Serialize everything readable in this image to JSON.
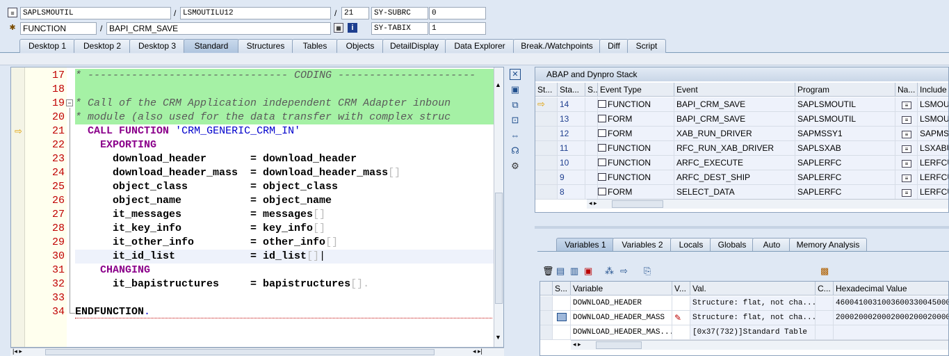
{
  "header": {
    "row1": {
      "program": "SAPLSMOUTIL",
      "include": "LSMOUTILU12",
      "line": "21",
      "sysvar": "SY-SUBRC",
      "sysval": "0"
    },
    "row2": {
      "type": "FUNCTION",
      "name": "BAPI_CRM_SAVE",
      "sysvar": "SY-TABIX",
      "sysval": "1"
    },
    "slash": "/"
  },
  "tabs": [
    "Desktop 1",
    "Desktop 2",
    "Desktop 3",
    "Standard",
    "Structures",
    "Tables",
    "Objects",
    "DetailDisplay",
    "Data Explorer",
    "Break./Watchpoints",
    "Diff",
    "Script"
  ],
  "active_tab": "Standard",
  "editor": {
    "lines": [
      {
        "n": "17",
        "segs": [
          {
            "t": "* -------------------------------- CODING ----------------------",
            "c": "cmt"
          }
        ]
      },
      {
        "n": "18",
        "segs": [
          {
            "t": "",
            "c": "cmt"
          }
        ]
      },
      {
        "n": "19",
        "segs": [
          {
            "t": "* Call of the CRM Application independent CRM Adapter inboun",
            "c": "cmt"
          }
        ]
      },
      {
        "n": "20",
        "segs": [
          {
            "t": "* module (also used for the data transfer with complex struc",
            "c": "cmt"
          }
        ]
      },
      {
        "n": "21",
        "segs": [
          {
            "t": "  ",
            "c": ""
          },
          {
            "t": "CALL FUNCTION",
            "c": "kw"
          },
          {
            "t": " ",
            "c": ""
          },
          {
            "t": "'CRM_GENERIC_CRM_IN'",
            "c": "str"
          }
        ]
      },
      {
        "n": "22",
        "segs": [
          {
            "t": "    ",
            "c": ""
          },
          {
            "t": "EXPORTING",
            "c": "kw"
          }
        ]
      },
      {
        "n": "23",
        "segs": [
          {
            "t": "      download_header       = download_header",
            "c": "bold"
          }
        ]
      },
      {
        "n": "24",
        "segs": [
          {
            "t": "      download_header_mass  = download_header_mass",
            "c": "bold"
          },
          {
            "t": "[]",
            "c": "br"
          }
        ]
      },
      {
        "n": "25",
        "segs": [
          {
            "t": "      object_class          = object_class",
            "c": "bold"
          }
        ]
      },
      {
        "n": "26",
        "segs": [
          {
            "t": "      object_name           = object_name",
            "c": "bold"
          }
        ]
      },
      {
        "n": "27",
        "segs": [
          {
            "t": "      it_messages           = messages",
            "c": "bold"
          },
          {
            "t": "[]",
            "c": "br"
          }
        ]
      },
      {
        "n": "28",
        "segs": [
          {
            "t": "      it_key_info           = key_info",
            "c": "bold"
          },
          {
            "t": "[]",
            "c": "br"
          }
        ]
      },
      {
        "n": "29",
        "segs": [
          {
            "t": "      it_other_info         = other_info",
            "c": "bold"
          },
          {
            "t": "[]",
            "c": "br"
          }
        ]
      },
      {
        "n": "30",
        "segs": [
          {
            "t": "      it_id_list            = id_list",
            "c": "bold"
          },
          {
            "t": "[]",
            "c": "br"
          },
          {
            "t": "|",
            "c": ""
          }
        ]
      },
      {
        "n": "31",
        "segs": [
          {
            "t": "    ",
            "c": ""
          },
          {
            "t": "CHANGING",
            "c": "kw"
          }
        ]
      },
      {
        "n": "32",
        "segs": [
          {
            "t": "      it_bapistructures     = bapistructures",
            "c": "bold"
          },
          {
            "t": "[].",
            "c": "br"
          }
        ]
      },
      {
        "n": "33",
        "segs": [
          {
            "t": "",
            "c": ""
          }
        ]
      },
      {
        "n": "34",
        "segs": [
          {
            "t": "ENDFUNCTION",
            "c": "bold"
          },
          {
            "t": ".",
            "c": "str"
          }
        ]
      }
    ]
  },
  "stack": {
    "title": "ABAP and Dynpro Stack",
    "columns": [
      "St...",
      "Sta...",
      "S...",
      "Event Type",
      "Event",
      "Program",
      "Na...",
      "Include"
    ],
    "rows": [
      {
        "level": "14",
        "type": "FUNCTION",
        "event": "BAPI_CRM_SAVE",
        "program": "SAPLSMOUTIL",
        "include": "LSMOUT"
      },
      {
        "level": "13",
        "type": "FORM",
        "event": "BAPI_CRM_SAVE",
        "program": "SAPLSMOUTIL",
        "include": "LSMOUT"
      },
      {
        "level": "12",
        "type": "FORM",
        "event": "XAB_RUN_DRIVER",
        "program": "SAPMSSY1",
        "include": "SAPMSS"
      },
      {
        "level": "11",
        "type": "FUNCTION",
        "event": "RFC_RUN_XAB_DRIVER",
        "program": "SAPLSXAB",
        "include": "LSXABU"
      },
      {
        "level": "10",
        "type": "FUNCTION",
        "event": "ARFC_EXECUTE",
        "program": "SAPLERFC",
        "include": "LERFCU"
      },
      {
        "level": "9",
        "type": "FUNCTION",
        "event": "ARFC_DEST_SHIP",
        "program": "SAPLERFC",
        "include": "LERFCU"
      },
      {
        "level": "8",
        "type": "FORM",
        "event": "SELECT_DATA",
        "program": "SAPLERFC",
        "include": "LERFCU"
      }
    ]
  },
  "var_tabs": [
    "Variables 1",
    "Variables 2",
    "Locals",
    "Globals",
    "Auto",
    "Memory Analysis"
  ],
  "vars": {
    "columns": [
      "S...",
      "Variable",
      "V...",
      "Val.",
      "C...",
      "Hexadecimal Value"
    ],
    "rows": [
      {
        "name": "DOWNLOAD_HEADER",
        "val": "Structure: flat, not cha...",
        "hex": "4600410031003600330045000"
      },
      {
        "name": "DOWNLOAD_HEADER_MASS",
        "val": "Structure: flat, not cha...",
        "hex": "2000200020002000200020000"
      },
      {
        "name": "DOWNLOAD_HEADER_MAS...",
        "val": "[0x37(732)]Standard Table",
        "hex": ""
      }
    ]
  },
  "colors": {
    "accent": "#c00000",
    "comment_bg": "#a5f1a5",
    "keyword": "#8b008b",
    "string": "#0000cc"
  }
}
